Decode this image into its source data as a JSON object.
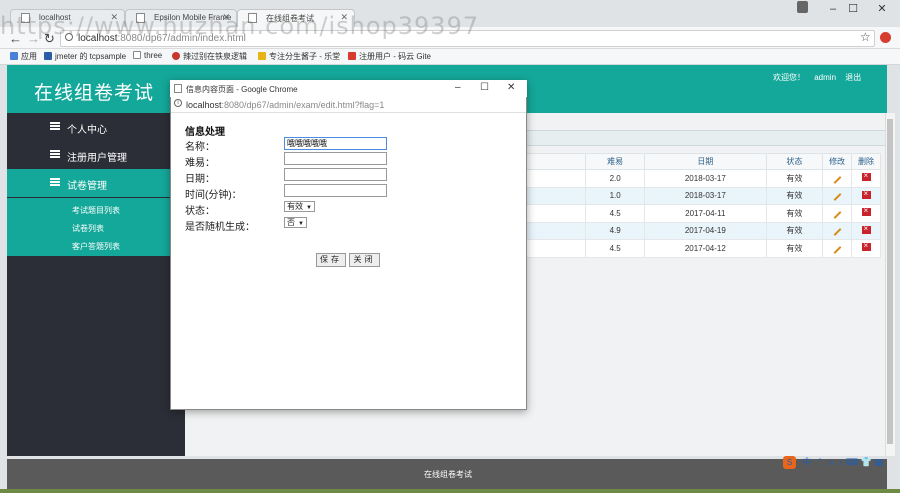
{
  "browser": {
    "tabs": [
      {
        "label": "localhost"
      },
      {
        "label": "Epsilon Mobile Frame"
      },
      {
        "label": "在线组卷考试"
      }
    ],
    "window_controls": {
      "minimize": "–",
      "maximize": "☐",
      "close": "✕"
    },
    "url_host": "localhost",
    "url_path": ":8080/dp67/admin/index.html",
    "bookmarks": [
      {
        "label": "应用",
        "color": "#4a7fd8"
      },
      {
        "label": "jmeter 的 tcpsample",
        "color": "#2a5ca8"
      },
      {
        "label": "three",
        "color": "#888888"
      },
      {
        "label": "辣过别在铁泉逻辑",
        "color": "#c8362c"
      },
      {
        "label": "专注分生酱子 - 乐堂",
        "color": "#e8b317"
      },
      {
        "label": "注册用户 - 码云 Gite",
        "color": "#d93a2c"
      }
    ]
  },
  "watermark": "https://www.huzhan.com/ishop39397",
  "app": {
    "title": "在线组卷考试",
    "welcome": "欢迎您！",
    "username": "admin",
    "logout": "退出",
    "sidebar": [
      {
        "label": "个人中心",
        "arrow": "‹"
      },
      {
        "label": "注册用户管理",
        "arrow": "‹"
      },
      {
        "label": "试卷管理",
        "arrow": "‹"
      }
    ],
    "submenu": [
      {
        "label": "考试题目列表"
      },
      {
        "label": "试卷列表"
      },
      {
        "label": "客户答题列表"
      }
    ],
    "table": {
      "headers": [
        "难易",
        "日期",
        "状态",
        "修改",
        "删除"
      ],
      "rows": [
        {
          "difficulty": "2.0",
          "date": "2018-03-17",
          "status": "有效"
        },
        {
          "difficulty": "1.0",
          "date": "2018-03-17",
          "status": "有效"
        },
        {
          "difficulty": "4.5",
          "date": "2017-04-11",
          "status": "有效"
        },
        {
          "difficulty": "4.9",
          "date": "2017-04-19",
          "status": "有效"
        },
        {
          "difficulty": "4.5",
          "date": "2017-04-12",
          "status": "有效"
        }
      ]
    },
    "footer": "在线组卷考试"
  },
  "modal": {
    "window_title": "信息内容页面 - Google Chrome",
    "url_host": "localhost",
    "url_path": ":8080/dp67/admin/exam/edit.html?flag=1",
    "heading": "信息处理",
    "fields": {
      "name_label": "名称：",
      "name_value": "哦哦哦哦哦",
      "difficulty_label": "难易：",
      "difficulty_value": "",
      "date_label": "日期：",
      "date_value": "",
      "duration_label": "时间(分钟)：",
      "duration_value": "",
      "status_label": "状态：",
      "status_value": "有效",
      "random_label": "是否随机生成：",
      "random_value": "否"
    },
    "save_label": "保存",
    "close_label": "关闭"
  },
  "ime": {
    "logo": "S",
    "lang": "中",
    "items": "°, ☺ ♪ ⌨ 👕 ▦"
  },
  "colors": {
    "header": "#14a89a",
    "sidebar": "#2c2e37",
    "footer": "#5a5a5a"
  }
}
